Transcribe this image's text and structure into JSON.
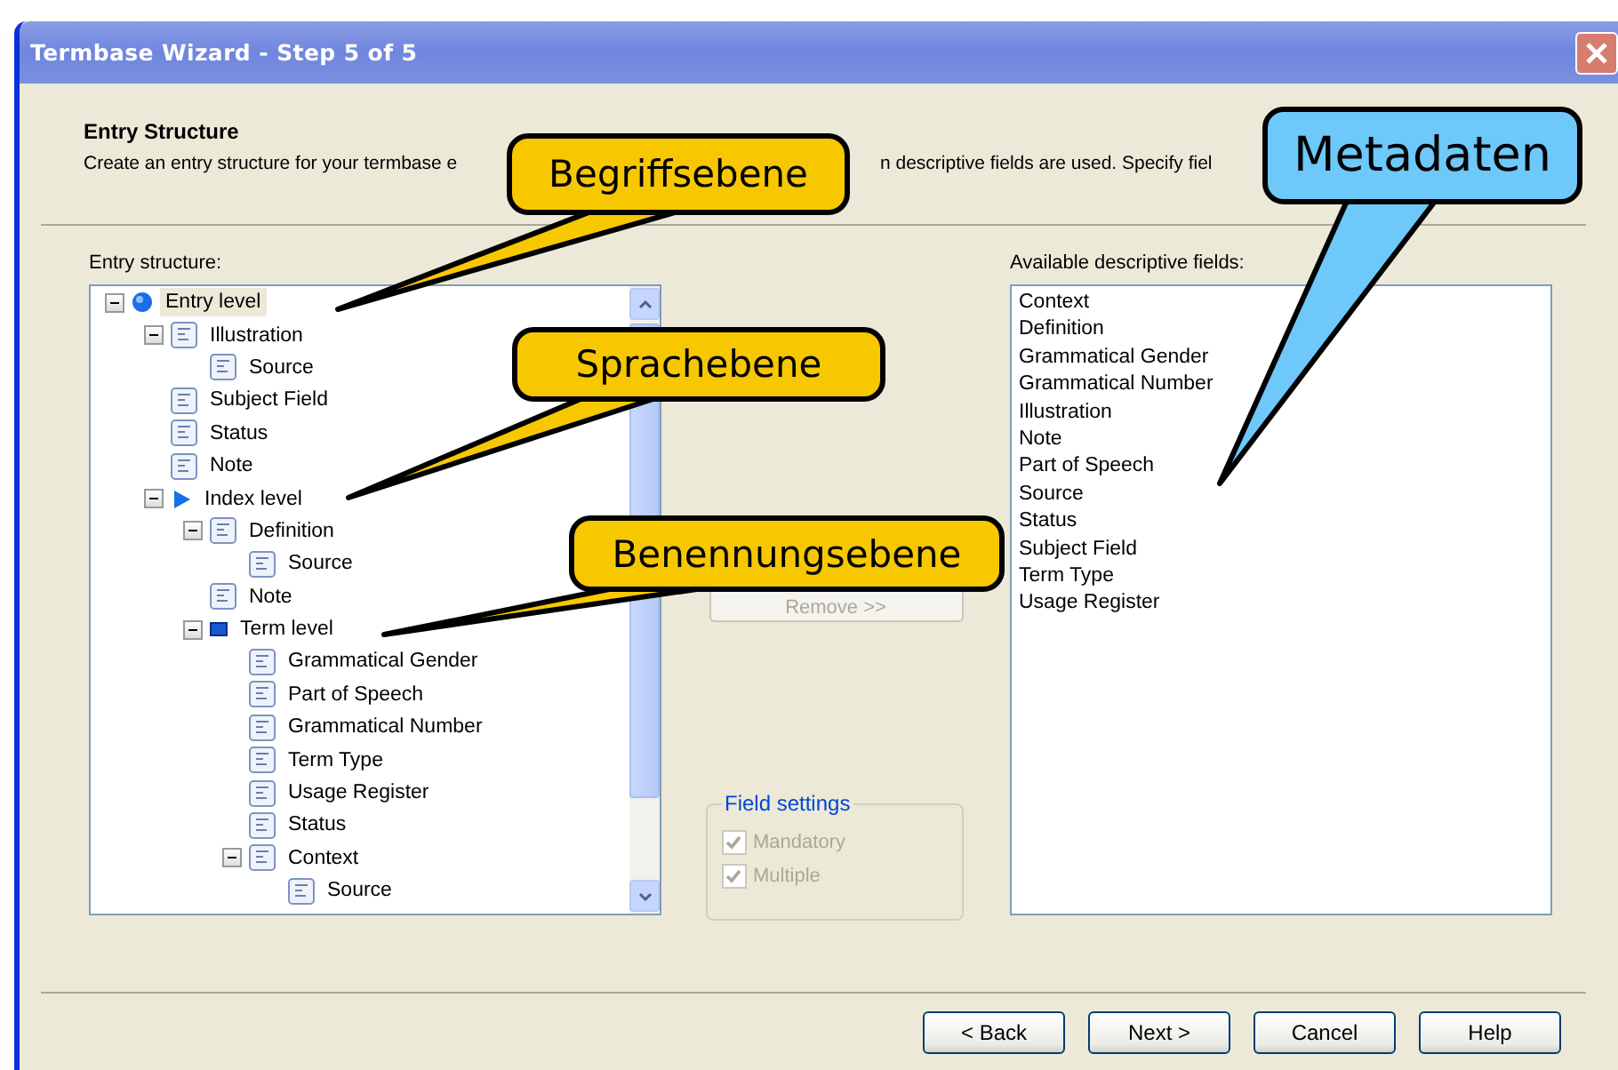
{
  "window": {
    "title": "Termbase Wizard - Step 5 of 5"
  },
  "header": {
    "title": "Entry Structure",
    "description_parts": [
      "Create an entry structure for your termbase e",
      "n descriptive fields are used. Specify fiel"
    ]
  },
  "entry_structure": {
    "label": "Entry structure:",
    "tree": [
      {
        "label": "Entry level",
        "kind": "entry",
        "expanded": true,
        "selected": true,
        "children": [
          {
            "label": "Illustration",
            "kind": "field",
            "expanded": true,
            "selected": false,
            "children": [
              {
                "label": "Source",
                "kind": "field",
                "selected": false
              }
            ]
          },
          {
            "label": "Subject Field",
            "kind": "field",
            "selected": false
          },
          {
            "label": "Status",
            "kind": "field",
            "selected": false
          },
          {
            "label": "Note",
            "kind": "field",
            "selected": false
          },
          {
            "label": "Index level",
            "kind": "index",
            "expanded": true,
            "selected": false,
            "children": [
              {
                "label": "Definition",
                "kind": "field",
                "expanded": true,
                "selected": false,
                "children": [
                  {
                    "label": "Source",
                    "kind": "field",
                    "selected": false
                  }
                ]
              },
              {
                "label": "Note",
                "kind": "field",
                "selected": false
              },
              {
                "label": "Term level",
                "kind": "term",
                "expanded": true,
                "selected": false,
                "children": [
                  {
                    "label": "Grammatical Gender",
                    "kind": "field",
                    "selected": false
                  },
                  {
                    "label": "Part of Speech",
                    "kind": "field",
                    "selected": false
                  },
                  {
                    "label": "Grammatical Number",
                    "kind": "field",
                    "selected": false
                  },
                  {
                    "label": "Term Type",
                    "kind": "field",
                    "selected": false
                  },
                  {
                    "label": "Usage Register",
                    "kind": "field",
                    "selected": false
                  },
                  {
                    "label": "Status",
                    "kind": "field",
                    "selected": false
                  },
                  {
                    "label": "Context",
                    "kind": "field",
                    "expanded": true,
                    "selected": false,
                    "children": [
                      {
                        "label": "Source",
                        "kind": "field",
                        "selected": false
                      }
                    ]
                  }
                ]
              }
            ]
          }
        ]
      }
    ]
  },
  "remove_button": {
    "label": "Remove >>",
    "disabled": true
  },
  "field_settings": {
    "title": "Field settings",
    "options": [
      {
        "label": "Mandatory",
        "checked": true,
        "disabled": true
      },
      {
        "label": "Multiple",
        "checked": true,
        "disabled": true
      }
    ]
  },
  "available_fields": {
    "label": "Available descriptive fields:",
    "items": [
      "Context",
      "Definition",
      "Grammatical Gender",
      "Grammatical Number",
      "Illustration",
      "Note",
      "Part of Speech",
      "Source",
      "Status",
      "Subject Field",
      "Term Type",
      "Usage Register"
    ]
  },
  "buttons": [
    "< Back",
    "Next >",
    "Cancel",
    "Help"
  ],
  "callouts": [
    {
      "text": "Begriffsebene",
      "color": "#f7c800"
    },
    {
      "text": "Sprachebene",
      "color": "#f7c800"
    },
    {
      "text": "Benennungsebene",
      "color": "#f7c800"
    },
    {
      "text": "Metadaten",
      "color": "#6ec8fa"
    }
  ]
}
